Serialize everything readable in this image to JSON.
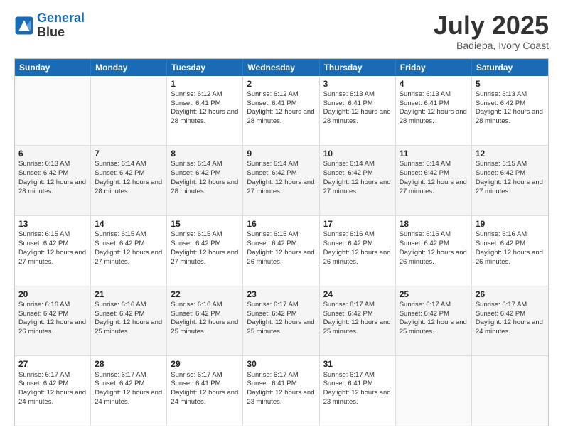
{
  "logo": {
    "line1": "General",
    "line2": "Blue"
  },
  "header": {
    "month": "July 2025",
    "location": "Badiepa, Ivory Coast"
  },
  "days": [
    "Sunday",
    "Monday",
    "Tuesday",
    "Wednesday",
    "Thursday",
    "Friday",
    "Saturday"
  ],
  "rows": [
    [
      {
        "day": "",
        "lines": []
      },
      {
        "day": "",
        "lines": []
      },
      {
        "day": "1",
        "lines": [
          "Sunrise: 6:12 AM",
          "Sunset: 6:41 PM",
          "Daylight: 12 hours and 28 minutes."
        ]
      },
      {
        "day": "2",
        "lines": [
          "Sunrise: 6:12 AM",
          "Sunset: 6:41 PM",
          "Daylight: 12 hours and 28 minutes."
        ]
      },
      {
        "day": "3",
        "lines": [
          "Sunrise: 6:13 AM",
          "Sunset: 6:41 PM",
          "Daylight: 12 hours and 28 minutes."
        ]
      },
      {
        "day": "4",
        "lines": [
          "Sunrise: 6:13 AM",
          "Sunset: 6:41 PM",
          "Daylight: 12 hours and 28 minutes."
        ]
      },
      {
        "day": "5",
        "lines": [
          "Sunrise: 6:13 AM",
          "Sunset: 6:42 PM",
          "Daylight: 12 hours and 28 minutes."
        ]
      }
    ],
    [
      {
        "day": "6",
        "lines": [
          "Sunrise: 6:13 AM",
          "Sunset: 6:42 PM",
          "Daylight: 12 hours and 28 minutes."
        ]
      },
      {
        "day": "7",
        "lines": [
          "Sunrise: 6:14 AM",
          "Sunset: 6:42 PM",
          "Daylight: 12 hours and 28 minutes."
        ]
      },
      {
        "day": "8",
        "lines": [
          "Sunrise: 6:14 AM",
          "Sunset: 6:42 PM",
          "Daylight: 12 hours and 28 minutes."
        ]
      },
      {
        "day": "9",
        "lines": [
          "Sunrise: 6:14 AM",
          "Sunset: 6:42 PM",
          "Daylight: 12 hours and 27 minutes."
        ]
      },
      {
        "day": "10",
        "lines": [
          "Sunrise: 6:14 AM",
          "Sunset: 6:42 PM",
          "Daylight: 12 hours and 27 minutes."
        ]
      },
      {
        "day": "11",
        "lines": [
          "Sunrise: 6:14 AM",
          "Sunset: 6:42 PM",
          "Daylight: 12 hours and 27 minutes."
        ]
      },
      {
        "day": "12",
        "lines": [
          "Sunrise: 6:15 AM",
          "Sunset: 6:42 PM",
          "Daylight: 12 hours and 27 minutes."
        ]
      }
    ],
    [
      {
        "day": "13",
        "lines": [
          "Sunrise: 6:15 AM",
          "Sunset: 6:42 PM",
          "Daylight: 12 hours and 27 minutes."
        ]
      },
      {
        "day": "14",
        "lines": [
          "Sunrise: 6:15 AM",
          "Sunset: 6:42 PM",
          "Daylight: 12 hours and 27 minutes."
        ]
      },
      {
        "day": "15",
        "lines": [
          "Sunrise: 6:15 AM",
          "Sunset: 6:42 PM",
          "Daylight: 12 hours and 27 minutes."
        ]
      },
      {
        "day": "16",
        "lines": [
          "Sunrise: 6:15 AM",
          "Sunset: 6:42 PM",
          "Daylight: 12 hours and 26 minutes."
        ]
      },
      {
        "day": "17",
        "lines": [
          "Sunrise: 6:16 AM",
          "Sunset: 6:42 PM",
          "Daylight: 12 hours and 26 minutes."
        ]
      },
      {
        "day": "18",
        "lines": [
          "Sunrise: 6:16 AM",
          "Sunset: 6:42 PM",
          "Daylight: 12 hours and 26 minutes."
        ]
      },
      {
        "day": "19",
        "lines": [
          "Sunrise: 6:16 AM",
          "Sunset: 6:42 PM",
          "Daylight: 12 hours and 26 minutes."
        ]
      }
    ],
    [
      {
        "day": "20",
        "lines": [
          "Sunrise: 6:16 AM",
          "Sunset: 6:42 PM",
          "Daylight: 12 hours and 26 minutes."
        ]
      },
      {
        "day": "21",
        "lines": [
          "Sunrise: 6:16 AM",
          "Sunset: 6:42 PM",
          "Daylight: 12 hours and 25 minutes."
        ]
      },
      {
        "day": "22",
        "lines": [
          "Sunrise: 6:16 AM",
          "Sunset: 6:42 PM",
          "Daylight: 12 hours and 25 minutes."
        ]
      },
      {
        "day": "23",
        "lines": [
          "Sunrise: 6:17 AM",
          "Sunset: 6:42 PM",
          "Daylight: 12 hours and 25 minutes."
        ]
      },
      {
        "day": "24",
        "lines": [
          "Sunrise: 6:17 AM",
          "Sunset: 6:42 PM",
          "Daylight: 12 hours and 25 minutes."
        ]
      },
      {
        "day": "25",
        "lines": [
          "Sunrise: 6:17 AM",
          "Sunset: 6:42 PM",
          "Daylight: 12 hours and 25 minutes."
        ]
      },
      {
        "day": "26",
        "lines": [
          "Sunrise: 6:17 AM",
          "Sunset: 6:42 PM",
          "Daylight: 12 hours and 24 minutes."
        ]
      }
    ],
    [
      {
        "day": "27",
        "lines": [
          "Sunrise: 6:17 AM",
          "Sunset: 6:42 PM",
          "Daylight: 12 hours and 24 minutes."
        ]
      },
      {
        "day": "28",
        "lines": [
          "Sunrise: 6:17 AM",
          "Sunset: 6:42 PM",
          "Daylight: 12 hours and 24 minutes."
        ]
      },
      {
        "day": "29",
        "lines": [
          "Sunrise: 6:17 AM",
          "Sunset: 6:41 PM",
          "Daylight: 12 hours and 24 minutes."
        ]
      },
      {
        "day": "30",
        "lines": [
          "Sunrise: 6:17 AM",
          "Sunset: 6:41 PM",
          "Daylight: 12 hours and 23 minutes."
        ]
      },
      {
        "day": "31",
        "lines": [
          "Sunrise: 6:17 AM",
          "Sunset: 6:41 PM",
          "Daylight: 12 hours and 23 minutes."
        ]
      },
      {
        "day": "",
        "lines": []
      },
      {
        "day": "",
        "lines": []
      }
    ]
  ]
}
